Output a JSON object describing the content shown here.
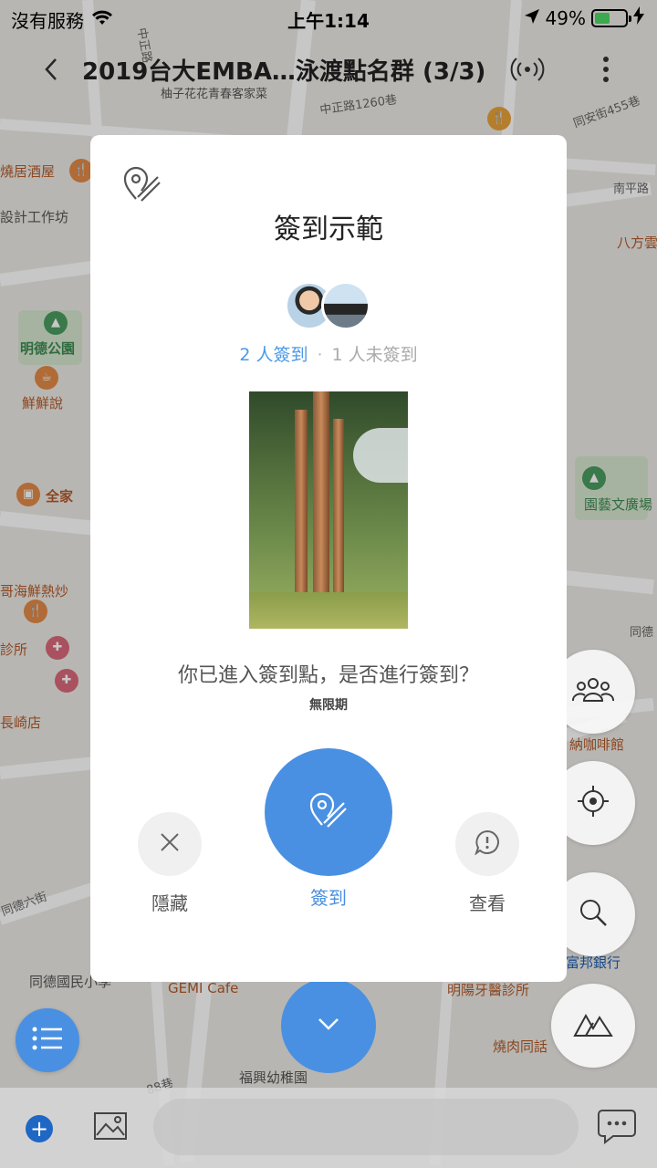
{
  "status_bar": {
    "carrier": "沒有服務",
    "time": "上午1:14",
    "battery": "49%",
    "battery_level": 0.49
  },
  "header": {
    "title": "2019台大EMBA…泳渡點名群 (3/3)",
    "icons": [
      "back-chevron-icon",
      "broadcast-signal-icon",
      "more-vertical-icon"
    ]
  },
  "map": {
    "streets": [
      "中正路1260巷",
      "同安街455巷",
      "中正路",
      "南平路",
      "同德六街",
      "同德",
      "88巷"
    ],
    "pois": [
      "燒居酒屋",
      "設計工作坊",
      "明德公園",
      "鮮鮮說",
      "全家",
      "哥海鮮熱炒",
      "診所",
      "長崎店",
      "同德國民小學",
      "GEMI Cafe",
      "明陽牙醫診所",
      "燒肉同話",
      "福興幼稚園",
      "八方雲",
      "園藝文廣場",
      "納咖啡館",
      "富邦銀行",
      "柚子花花青春客家菜"
    ]
  },
  "modal": {
    "icon": "checkin-pin-icon",
    "title": "簽到示範",
    "signed_count": "2 人簽到",
    "separator": "·",
    "unsigned_count": "1 人未簽到",
    "question": "你已進入簽到點，是否進行簽到？",
    "expiry": "無限期",
    "actions": {
      "hide": "隱藏",
      "checkin": "簽到",
      "view": "查看"
    }
  },
  "floating_buttons": [
    "members-icon",
    "locate-icon",
    "search-icon",
    "terrain-icon",
    "list-icon",
    "chevron-down-icon"
  ],
  "bottom_bar": {
    "icons": [
      "plus-icon",
      "image-icon",
      "chat-icon"
    ],
    "input_value": ""
  },
  "colors": {
    "accent": "#4a90e2",
    "battery": "#4cd964"
  }
}
